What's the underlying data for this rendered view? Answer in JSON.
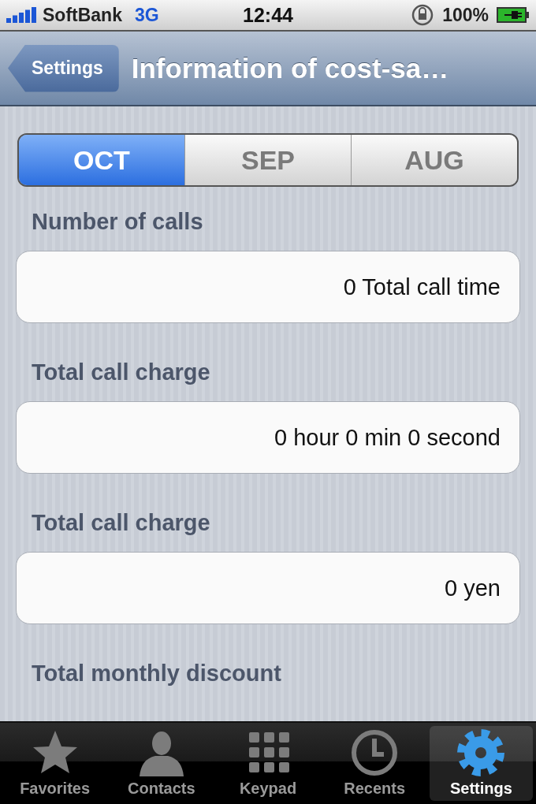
{
  "status_bar": {
    "carrier": "SoftBank",
    "network": "3G",
    "time": "12:44",
    "battery": "100%"
  },
  "nav_bar": {
    "back": "Settings",
    "title": "Information of cost-sa…"
  },
  "segments": [
    {
      "label": "OCT",
      "selected": true
    },
    {
      "label": "SEP",
      "selected": false
    },
    {
      "label": "AUG",
      "selected": false
    }
  ],
  "sections": [
    {
      "heading": "Number of calls",
      "value": "0 Total call time"
    },
    {
      "heading": "Total call charge",
      "value": "0 hour 0 min 0 second"
    },
    {
      "heading": "Total call charge",
      "value": "0 yen"
    },
    {
      "heading": "Total monthly discount"
    }
  ],
  "tab_bar": [
    {
      "kind": "star",
      "label": "Favorites",
      "selected": false
    },
    {
      "kind": "person",
      "label": "Contacts",
      "selected": false
    },
    {
      "kind": "keypad",
      "label": "Keypad",
      "selected": false
    },
    {
      "kind": "clock",
      "label": "Recents",
      "selected": false
    },
    {
      "kind": "gear",
      "label": "Settings",
      "selected": true
    }
  ]
}
